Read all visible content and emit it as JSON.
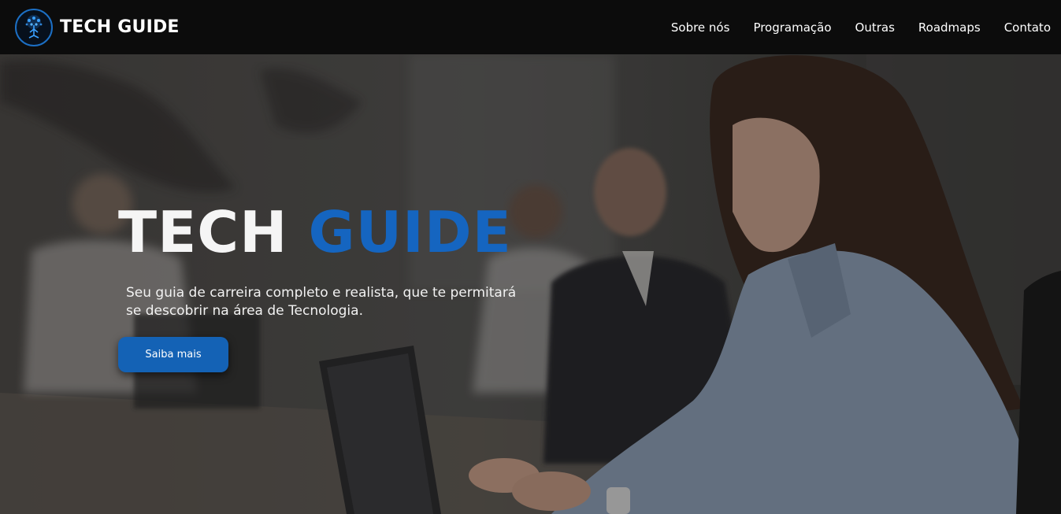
{
  "header": {
    "brand": "TECH GUIDE",
    "logo_icon": "tree-circuit-icon",
    "nav": [
      {
        "label": "Sobre nós"
      },
      {
        "label": "Programação"
      },
      {
        "label": "Outras"
      },
      {
        "label": "Roadmaps"
      },
      {
        "label": "Contato"
      }
    ]
  },
  "hero": {
    "title_part1": "TECH",
    "title_part2": "GUIDE",
    "subtitle_line1": "Seu guia de carreira completo e realista, que te permitará",
    "subtitle_line2": "se descobrir na área de Tecnologia.",
    "cta_label": "Saiba mais",
    "background_image": "office-team-with-laptops-photo"
  },
  "colors": {
    "navbar_bg": "#0c0c0c",
    "accent_blue": "#1565c0",
    "button_bg": "#1462b5",
    "text_white": "#ffffff"
  }
}
